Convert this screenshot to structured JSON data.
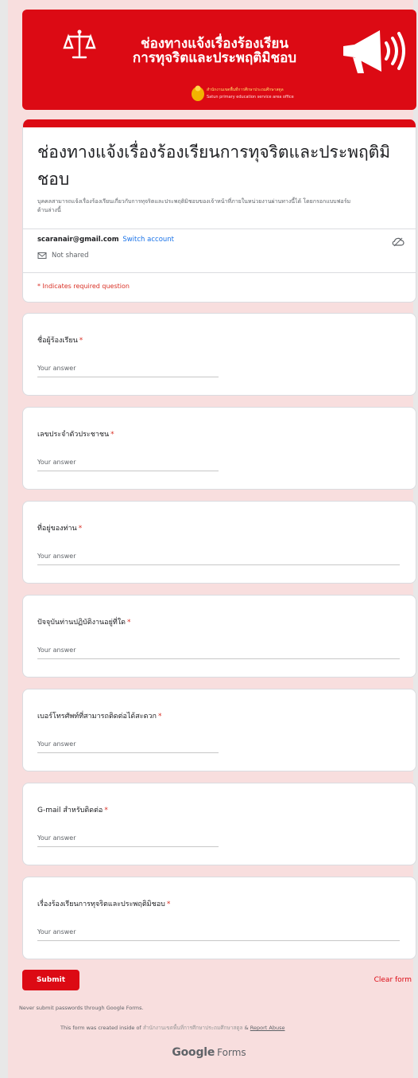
{
  "banner": {
    "heading_line1": "ช่องทางแจ้งเรื่องร้องเรียน",
    "heading_line2": "การทุจริตและประพฤติมิชอบ",
    "org_name_th": "สำนักงานเขตพื้นที่การศึกษาประถมศึกษาสตูล",
    "org_name_en": "Satun primary education service area office"
  },
  "form": {
    "title": "ช่องทางแจ้งเรื่องร้องเรียนการทุจริตและประพฤติมิชอบ",
    "description": "บุคคลสามารถแจ้งเรื่องร้องเรียนเกี่ยวกับการทุจริตและประพฤติมิชอบของเจ้าหน้าที่ภายในหน่วยงานผ่านทางนี้ได้ โดยกรอกแบบฟอร์มด้านล่างนี้",
    "account_email": "scaranair@gmail.com",
    "switch_account": "Switch account",
    "not_shared": "Not shared",
    "required_note": "* Indicates required question"
  },
  "questions": [
    {
      "label": "ชื่อผู้ร้องเรียน",
      "placeholder": "Your answer"
    },
    {
      "label": "เลขประจำตัวประชาชน",
      "placeholder": "Your answer"
    },
    {
      "label": "ที่อยู่ของท่าน",
      "placeholder": "Your answer"
    },
    {
      "label": "ปัจจุบันท่านปฏิบัติงานอยู่ที่ใด",
      "placeholder": "Your answer"
    },
    {
      "label": "เบอร์โทรศัพท์ที่สามารถติดต่อได้สะดวก",
      "placeholder": "Your answer"
    },
    {
      "label": "G-mail สำหรับติดต่อ",
      "placeholder": "Your answer"
    },
    {
      "label": "เรื่องร้องเรียนการทุจริตและประพฤติมิชอบ",
      "placeholder": "Your answer"
    }
  ],
  "required_star": "*",
  "actions": {
    "submit": "Submit",
    "clear": "Clear form"
  },
  "footer": {
    "never_submit": "Never submit passwords through Google Forms.",
    "created_prefix": "This form was created inside of",
    "created_org": "สำนักงานเขตพื้นที่การศึกษาประถมศึกษาสตูล",
    "created_sep": "&",
    "report_abuse": "Report Abuse",
    "brand": "Google",
    "product": "Forms"
  },
  "colors": {
    "accent": "#dc0a14",
    "page_bg": "#f8dede",
    "link": "#1a73e8",
    "required": "#d93025"
  },
  "icons": [
    "scales-of-justice-icon",
    "megaphone-icon",
    "emblem-icon",
    "cloud-icon",
    "not-shared-icon"
  ]
}
